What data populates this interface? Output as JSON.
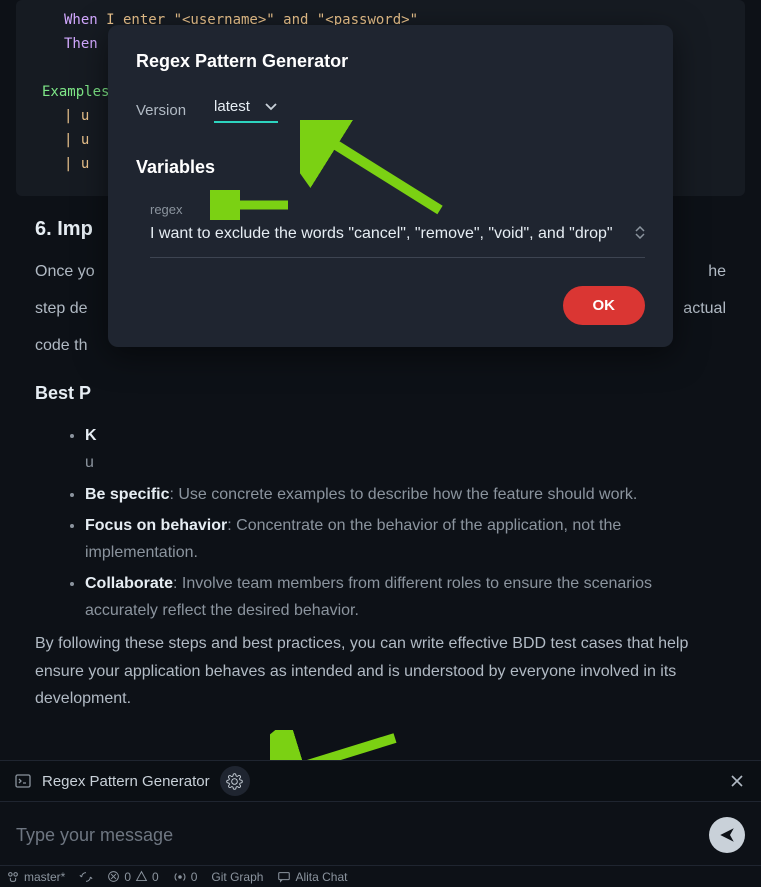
{
  "code": {
    "line1_kw": "When",
    "line1_text": " I enter \"<username>\" and \"<password>\"",
    "line2_kw": "Then",
    "line3_kw": "Examples",
    "pipe_lines": [
      "| u",
      "| u",
      "| u"
    ]
  },
  "content": {
    "heading6_prefix": "6. Imp",
    "para1_pre": "Once yo",
    "para1_post_he": "he",
    "para2_pre": "step de",
    "para2_post": "actual",
    "para3": "code th",
    "best_heading_prefix": "Best P",
    "practices": [
      {
        "strong": "K",
        "rest_first": "",
        "cont": "u"
      },
      {
        "strong": "Be specific",
        "rest": ": Use concrete examples to describe how the feature should work."
      },
      {
        "strong": "Focus on behavior",
        "rest": ": Concentrate on the behavior of the application, not the implementation."
      },
      {
        "strong": "Collaborate",
        "rest": ": Involve team members from different roles to ensure the scenarios accurately reflect the desired behavior."
      }
    ],
    "closing": "By following these steps and best practices, you can write effective BDD test cases that help ensure your application behaves as intended and is understood by everyone involved in its development."
  },
  "modal": {
    "title": "Regex Pattern Generator",
    "version_label": "Version",
    "version_value": "latest",
    "variables_heading": "Variables",
    "regex_label": "regex",
    "regex_value": "I want to exclude the words \"cancel\", \"remove\", \"void\", and \"drop\"",
    "ok_label": "OK"
  },
  "toolbar": {
    "label": "Regex Pattern Generator"
  },
  "message": {
    "placeholder": "Type your message"
  },
  "status": {
    "branch": "master*",
    "errors": "0",
    "warnings": "0",
    "ports": "0",
    "git_graph": "Git Graph",
    "alita": "Alita Chat"
  }
}
